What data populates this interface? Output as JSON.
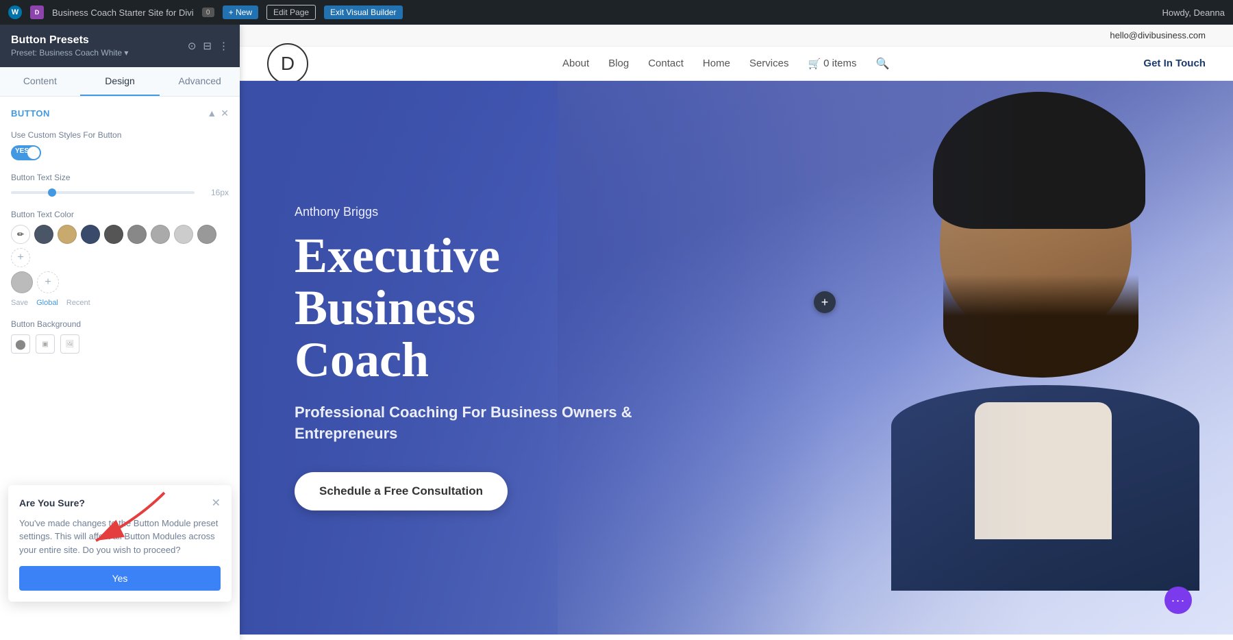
{
  "admin_bar": {
    "wp_label": "W",
    "divi_label": "D",
    "site_name": "Business Coach Starter Site for Divi",
    "comments": "0",
    "new_label": "+ New",
    "edit_label": "Edit Page",
    "exit_label": "Exit Visual Builder",
    "howdy": "Howdy, Deanna"
  },
  "panel": {
    "title": "Button Presets",
    "subtitle": "Preset: Business Coach White ▾",
    "tabs": [
      "Content",
      "Design",
      "Advanced"
    ],
    "active_tab": "Design",
    "section_title": "Button",
    "fields": {
      "custom_styles_label": "Use Custom Styles For Button",
      "toggle_state": "YES",
      "text_size_label": "Button Text Size",
      "text_size_value": "16px",
      "text_color_label": "Button Text Color",
      "colors": [
        {
          "type": "pencil",
          "value": ""
        },
        {
          "type": "swatch",
          "color": "#4a5568"
        },
        {
          "type": "swatch",
          "color": "#c8a96e"
        },
        {
          "type": "swatch",
          "color": "#3a4a6b"
        },
        {
          "type": "swatch",
          "color": "#555"
        },
        {
          "type": "swatch",
          "color": "#888"
        },
        {
          "type": "swatch",
          "color": "#aaa"
        },
        {
          "type": "swatch",
          "color": "#ccc"
        },
        {
          "type": "swatch",
          "color": "#999"
        },
        {
          "type": "add",
          "value": "+"
        }
      ],
      "save_label": "Save",
      "global_label": "Global",
      "recent_label": "Recent",
      "bg_label": "Button Background"
    }
  },
  "confirm_dialog": {
    "title": "Are You Sure?",
    "body": "You've made changes to the Button Module preset settings. This will affect all Button Modules across your entire site. Do you wish to proceed?",
    "yes_label": "Yes"
  },
  "site": {
    "email": "hello@divibusiness.com",
    "logo_letter": "D",
    "nav": {
      "about": "About",
      "blog": "Blog",
      "contact": "Contact",
      "home": "Home",
      "services": "Services",
      "cart_items": "0 items",
      "cta": "Get In Touch"
    },
    "hero": {
      "name": "Anthony Briggs",
      "title_line1": "Executive Business",
      "title_line2": "Coach",
      "subtitle": "Professional Coaching For Business Owners & Entrepreneurs",
      "cta": "Schedule a Free Consultation"
    }
  }
}
